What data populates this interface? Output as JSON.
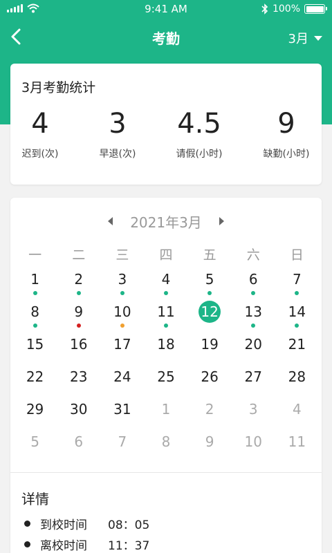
{
  "status_bar": {
    "time": "9:41 AM",
    "battery_text": "100%"
  },
  "nav": {
    "title": "考勤",
    "month_select": "3月"
  },
  "stats": {
    "title": "3月考勤统计",
    "items": [
      {
        "value": "4",
        "label": "迟到(次)"
      },
      {
        "value": "3",
        "label": "早退(次)"
      },
      {
        "value": "4.5",
        "label": "请假(小时)"
      },
      {
        "value": "9",
        "label": "缺勤(小时)"
      }
    ]
  },
  "calendar": {
    "title": "2021年3月",
    "weekdays": [
      "一",
      "二",
      "三",
      "四",
      "五",
      "六",
      "日"
    ],
    "days": [
      {
        "label": "1",
        "dot": "green"
      },
      {
        "label": "2",
        "dot": "green"
      },
      {
        "label": "3",
        "dot": "green"
      },
      {
        "label": "4",
        "dot": "green"
      },
      {
        "label": "5",
        "dot": "green"
      },
      {
        "label": "6",
        "dot": "green"
      },
      {
        "label": "7",
        "dot": "green"
      },
      {
        "label": "8",
        "dot": "green"
      },
      {
        "label": "9",
        "dot": "red"
      },
      {
        "label": "10",
        "dot": "orange"
      },
      {
        "label": "11",
        "dot": "green"
      },
      {
        "label": "12",
        "selected": true
      },
      {
        "label": "13",
        "dot": "green"
      },
      {
        "label": "14",
        "dot": "green"
      },
      {
        "label": "15"
      },
      {
        "label": "16"
      },
      {
        "label": "17"
      },
      {
        "label": "18"
      },
      {
        "label": "19"
      },
      {
        "label": "20"
      },
      {
        "label": "21"
      },
      {
        "label": "22"
      },
      {
        "label": "23"
      },
      {
        "label": "24"
      },
      {
        "label": "25"
      },
      {
        "label": "26"
      },
      {
        "label": "27"
      },
      {
        "label": "28"
      },
      {
        "label": "29"
      },
      {
        "label": "30"
      },
      {
        "label": "31"
      },
      {
        "label": "1",
        "other": true
      },
      {
        "label": "2",
        "other": true
      },
      {
        "label": "3",
        "other": true
      },
      {
        "label": "4",
        "other": true
      },
      {
        "label": "5",
        "other": true
      },
      {
        "label": "6",
        "other": true
      },
      {
        "label": "7",
        "other": true
      },
      {
        "label": "8",
        "other": true
      },
      {
        "label": "9",
        "other": true
      },
      {
        "label": "10",
        "other": true
      },
      {
        "label": "11",
        "other": true
      }
    ]
  },
  "details": {
    "title": "详情",
    "items": [
      {
        "label": "到校时间",
        "value": "08：05"
      },
      {
        "label": "离校时间",
        "value": "11：37"
      }
    ]
  },
  "colors": {
    "accent": "#1db588",
    "dot_green": "#1db588",
    "dot_red": "#d42020",
    "dot_orange": "#f0a030"
  }
}
